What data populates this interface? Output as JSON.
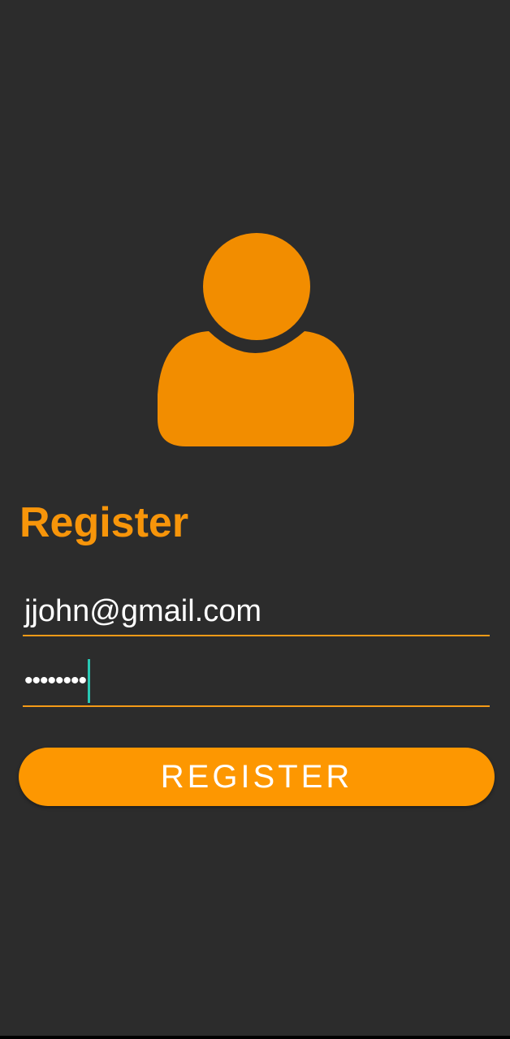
{
  "colors": {
    "background": "#2c2c2c",
    "accent": "#f7950a",
    "button": "#fd9701",
    "caret": "#28c8b4",
    "text": "#ffffff"
  },
  "avatar": {
    "icon": "user-icon"
  },
  "page": {
    "title": "Register"
  },
  "form": {
    "email_value": "jjohn@gmail.com",
    "password_mask": "••••••••",
    "submit_label": "REGISTER"
  }
}
